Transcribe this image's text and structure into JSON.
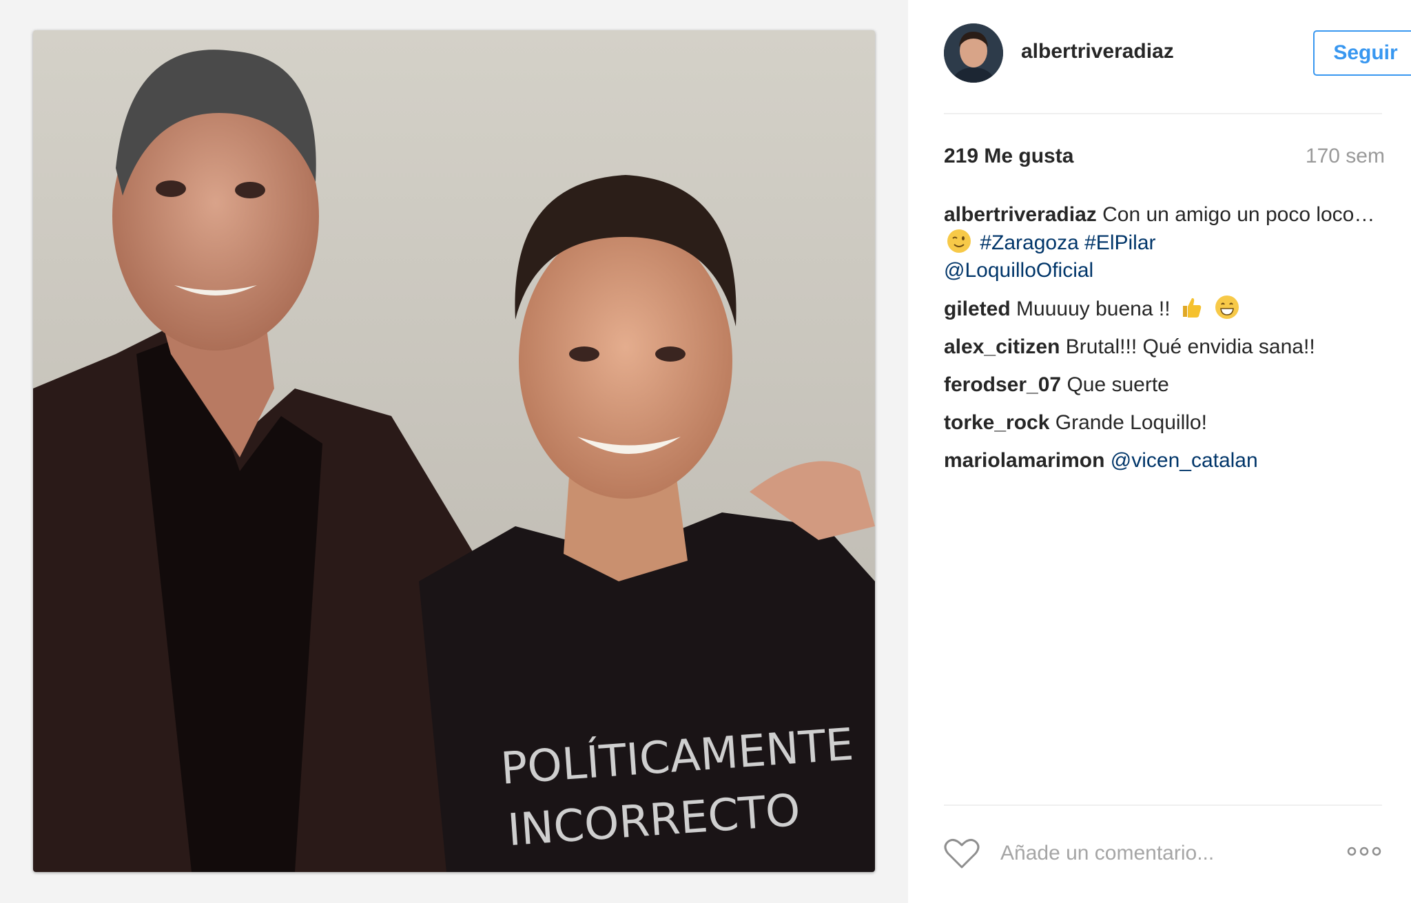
{
  "post": {
    "image_text": "POLÍTICAMENTE INCORRECTO"
  },
  "header": {
    "username": "albertriveradiaz",
    "follow_label": "Seguir"
  },
  "stats": {
    "likes": "219 Me gusta",
    "time": "170 sem"
  },
  "caption": {
    "user": "albertriveradiaz",
    "text": "Con un amigo un poco loco…",
    "emoji": "wink-emoji",
    "hashtag1": "#Zaragoza",
    "hashtag2": "#ElPilar",
    "mention": "@LoquilloOficial"
  },
  "comments": [
    {
      "user": "gileted",
      "text": "Muuuuy buena !!",
      "emojis": [
        "thumbs-up-emoji",
        "grin-emoji"
      ]
    },
    {
      "user": "alex_citizen",
      "text": "Brutal!!! Qué envidia sana!!"
    },
    {
      "user": "ferodser_07",
      "text": "Que suerte"
    },
    {
      "user": "torke_rock",
      "text": "Grande Loquillo!"
    },
    {
      "user": "mariolamarimon",
      "mention": "@vicen_catalan"
    }
  ],
  "footer": {
    "comment_placeholder": "Añade un comentario...",
    "like_icon": "heart-icon",
    "more_icon": "more-options-icon"
  },
  "colors": {
    "accent": "#3897f0",
    "link": "#003569",
    "muted": "#999999"
  }
}
